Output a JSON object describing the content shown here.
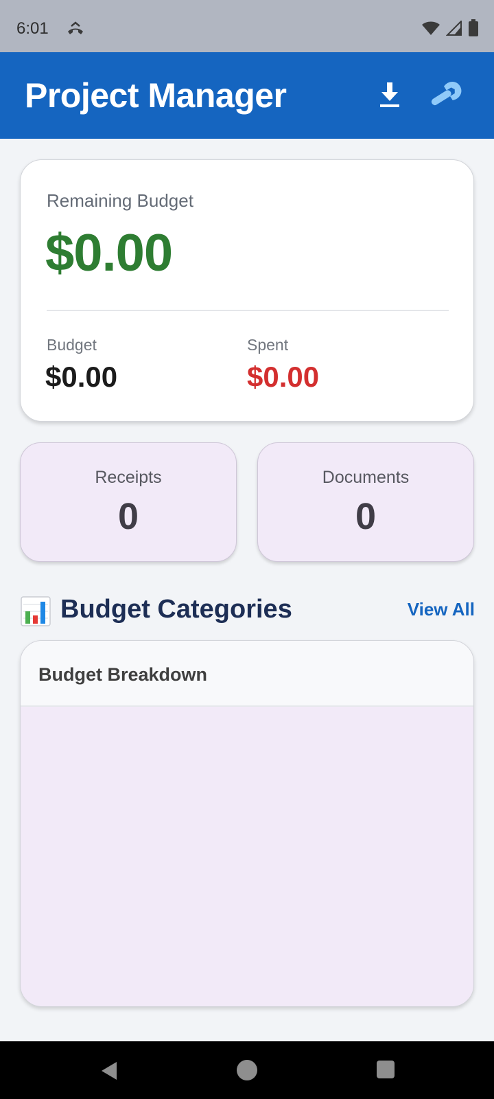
{
  "status_bar": {
    "time": "6:01",
    "icons": [
      "missed-call-icon",
      "wifi-icon",
      "signal-icon",
      "battery-icon"
    ]
  },
  "app_bar": {
    "title": "Project Manager",
    "actions": [
      "download-icon",
      "wrench-icon"
    ]
  },
  "budget_card": {
    "remaining_label": "Remaining Budget",
    "remaining_value": "$0.00",
    "budget_label": "Budget",
    "budget_value": "$0.00",
    "spent_label": "Spent",
    "spent_value": "$0.00"
  },
  "stats": {
    "receipts_label": "Receipts",
    "receipts_value": "0",
    "documents_label": "Documents",
    "documents_value": "0"
  },
  "categories": {
    "title": "Budget Categories",
    "icon": "bar-chart-icon",
    "view_all": "View All",
    "breakdown_title": "Budget Breakdown"
  },
  "colors": {
    "primary": "#1565c0",
    "remaining_green": "#2e7d32",
    "spent_red": "#d32f2f",
    "tile_bg": "#f2eaf8"
  }
}
